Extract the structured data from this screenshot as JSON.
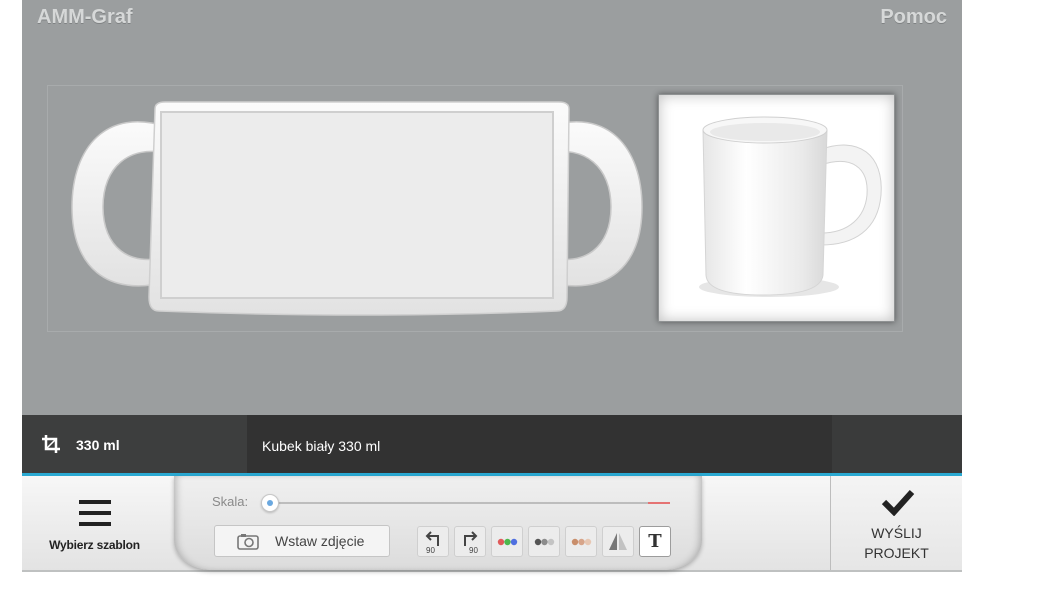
{
  "header": {
    "brand": "AMM-Graf",
    "help": "Pomoc"
  },
  "product": {
    "size": "330 ml",
    "name": "Kubek biały 330 ml"
  },
  "toolbar": {
    "choose_template": "Wybierz szablon",
    "scale_label": "Skala:",
    "insert_photo": "Wstaw zdjęcie",
    "rotate_left_label": "90",
    "rotate_right_label": "90",
    "text_tool": "T",
    "send_line1": "WYŚLIJ",
    "send_line2": "PROJEKT"
  },
  "colors": {
    "canvas": "#9b9e9f",
    "info_bar": "#323232",
    "accent": "#2aa9d2"
  },
  "icons": [
    "crop-icon",
    "menu-icon",
    "camera-icon",
    "rotate-left-icon",
    "rotate-right-icon",
    "color-filter-icon",
    "grayscale-filter-icon",
    "sepia-filter-icon",
    "flip-icon",
    "check-icon"
  ]
}
